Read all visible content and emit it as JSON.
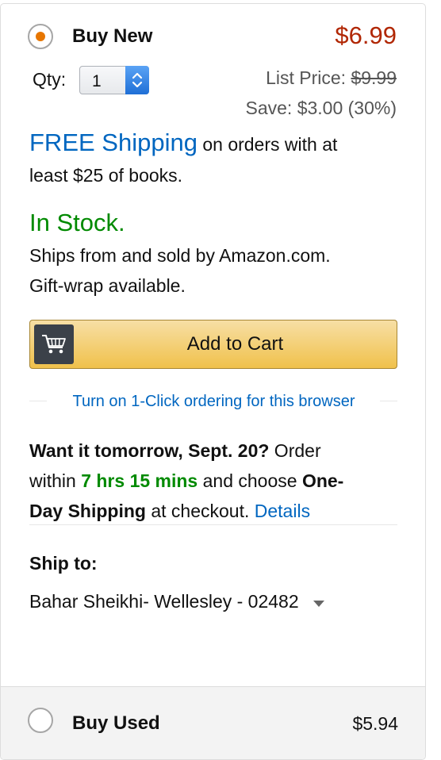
{
  "buy_new": {
    "label": "Buy New",
    "price": "$6.99",
    "selected": true
  },
  "quantity": {
    "label": "Qty:",
    "value": "1"
  },
  "pricing": {
    "list_price_label": "List Price:",
    "list_price": "$9.99",
    "save_text": "Save: $3.00 (30%)"
  },
  "shipping": {
    "free_shipping_link": "FREE Shipping",
    "line1_rest": " on orders with at",
    "line2": "least $25 of books."
  },
  "stock": {
    "status": "In Stock.",
    "line1": "Ships from and sold by Amazon.com.",
    "line2": "Gift-wrap available."
  },
  "cart": {
    "button_label": "Add to Cart",
    "icon": "cart-icon"
  },
  "one_click": {
    "link": "Turn on 1-Click ordering for this browser"
  },
  "delivery": {
    "bold_lead": "Want it tomorrow, Sept. 20?",
    "order_word": " Order",
    "within": "within ",
    "countdown": "7 hrs 15 mins",
    "and_choose": " and choose ",
    "one_part": "One-",
    "day_shipping": "Day Shipping",
    "at_checkout": " at checkout. ",
    "details_link": "Details"
  },
  "ship_to": {
    "label": "Ship to:",
    "address": "Bahar Sheikhi- Wellesley - 02482",
    "icon": "dropdown-triangle-icon"
  },
  "buy_used": {
    "label": "Buy Used",
    "price": "$5.94",
    "selected": false
  },
  "colors": {
    "price_red": "#b12704",
    "link_blue": "#0066c0",
    "stock_green": "#008a00",
    "radio_orange": "#e77600",
    "button_yellow": "#f0c14b"
  }
}
